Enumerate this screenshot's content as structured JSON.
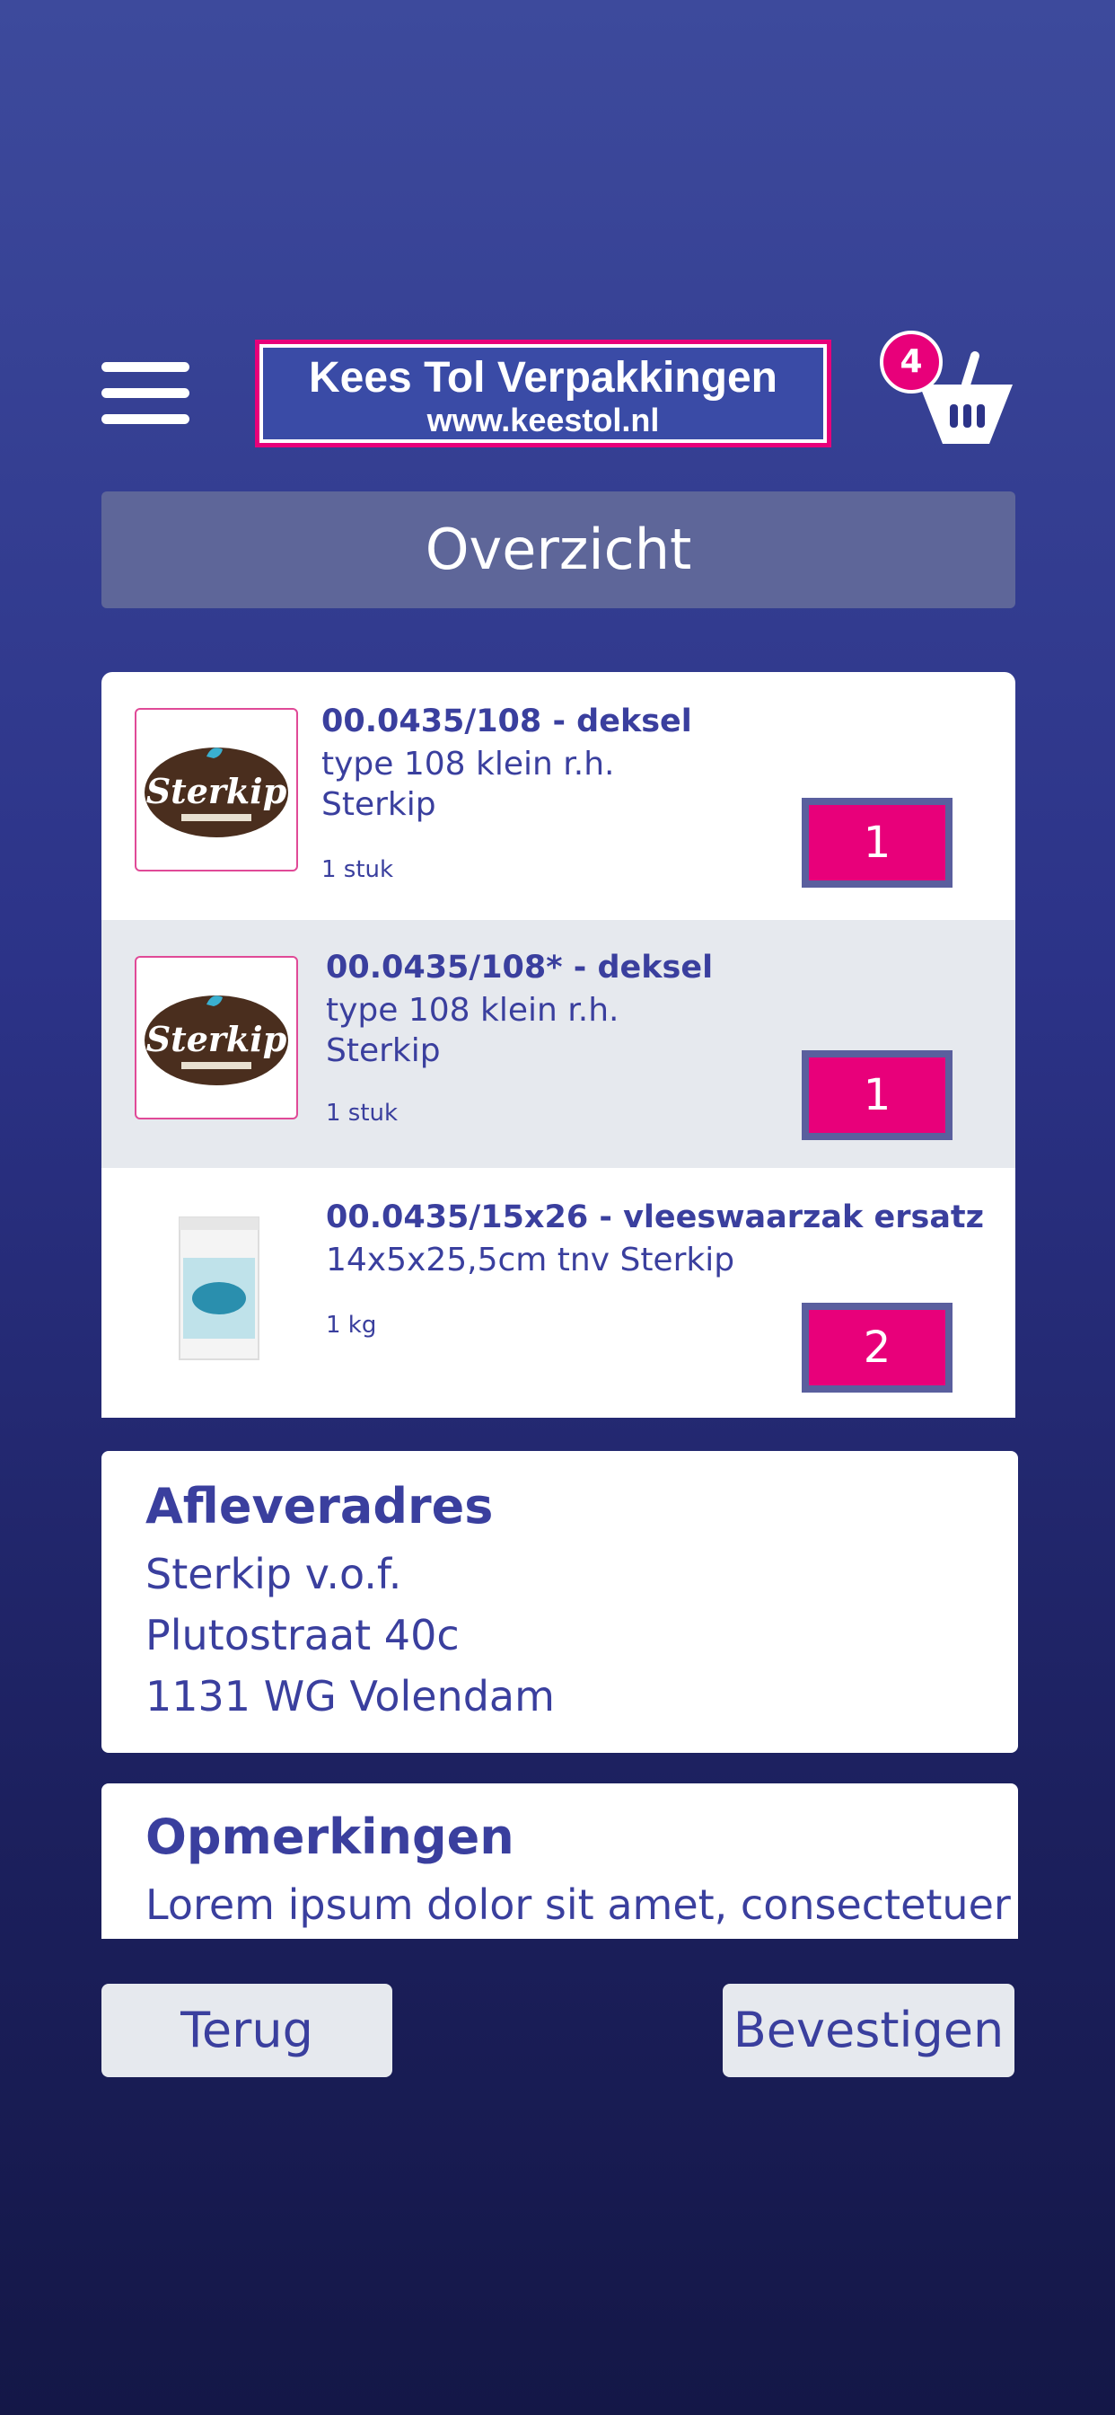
{
  "header": {
    "menu_icon": "hamburger-menu-icon",
    "logo_title": "Kees Tol Verpakkingen",
    "logo_url": "www.keestol.nl",
    "cart_icon": "basket-icon",
    "cart_count": "4"
  },
  "page_title": "Overzicht",
  "items": [
    {
      "code": "00.0435/108 - deksel",
      "line1": "type 108 klein r.h.",
      "line2": "Sterkip",
      "unit": "1 stuk",
      "qty": "1",
      "image": "sterkip-logo"
    },
    {
      "code": "00.0435/108* - deksel",
      "line1": "type 108 klein r.h.",
      "line2": "Sterkip",
      "unit": "1 stuk",
      "qty": "1",
      "image": "sterkip-logo"
    },
    {
      "code": "00.0435/15x26 - vleeswaarzak ersatz",
      "line1": "14x5x25,5cm tnv Sterkip",
      "line2": "",
      "unit": "1 kg",
      "qty": "2",
      "image": "paper-bag"
    }
  ],
  "logo_text": "Sterkip",
  "address": {
    "title": "Afleveradres",
    "name": "Sterkip v.o.f.",
    "street": "Plutostraat 40c",
    "city": "1131 WG Volendam"
  },
  "remarks": {
    "title": "Opmerkingen",
    "text": "Lorem ipsum dolor sit amet, consectetuer"
  },
  "buttons": {
    "back": "Terug",
    "confirm": "Bevestigen"
  },
  "colors": {
    "accent": "#e8007a",
    "text": "#3a3f9e",
    "background_top": "#3d4a9c",
    "background_bottom": "#141747"
  }
}
